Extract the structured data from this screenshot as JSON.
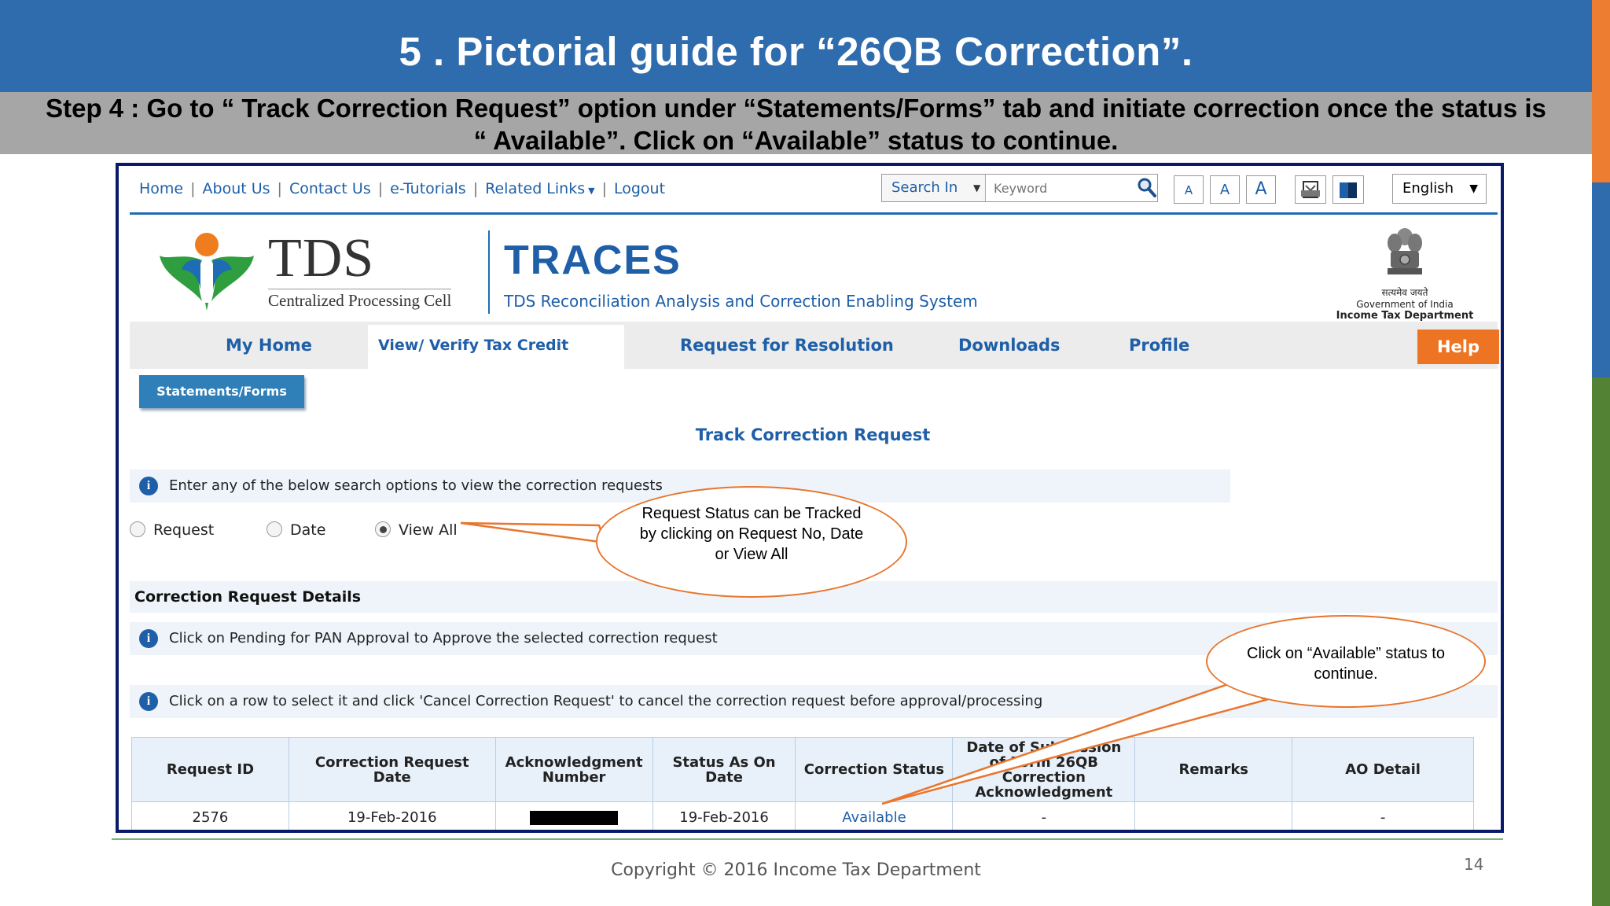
{
  "slide": {
    "title": "5 . Pictorial guide for “26QB Correction”.",
    "step_line1": "Step 4 : Go to “ Track Correction Request” option under “Statements/Forms” tab and initiate correction once the status is",
    "step_line2": "“ Available”. Click on “Available” status to continue.",
    "copyright": "Copyright © 2016 Income Tax Department",
    "page_number": "14"
  },
  "topnav": {
    "links": [
      "Home",
      "About Us",
      "Contact Us",
      "e-Tutorials",
      "Related Links",
      "Logout"
    ],
    "search_label": "Search In",
    "search_placeholder": "Keyword",
    "font_sizes": [
      "A",
      "A",
      "A"
    ],
    "language": "English"
  },
  "header": {
    "tds": "TDS",
    "cpc": "Centralized Processing Cell",
    "traces": "TRACES",
    "traces_sub": "TDS Reconciliation Analysis and Correction Enabling System",
    "emblem_hindi": "सत्यमेव जयते",
    "emblem_goi": "Government of India",
    "emblem_itd": "Income Tax Department"
  },
  "menu": {
    "items": [
      "My Home",
      "View/ Verify Tax Credit",
      "Request for Resolution",
      "Downloads",
      "Profile"
    ],
    "help": "Help",
    "sub_tab": "Statements/Forms"
  },
  "page": {
    "heading": "Track Correction Request",
    "search_info": "Enter any of the below search options to view the correction requests",
    "radios": [
      "Request",
      "Date",
      "View All"
    ],
    "section": "Correction Request Details",
    "info_pending": "Click on Pending for PAN Approval to Approve the selected correction request",
    "info_cancel": "Click on a row to select it and click 'Cancel Correction Request' to cancel the correction request before approval/processing"
  },
  "table": {
    "headers": [
      "Request ID",
      "Correction Request Date",
      "Acknowledgment Number",
      "Status As On Date",
      "Correction Status",
      "Date of Submission of Form 26QB Correction Acknowledgment",
      "Remarks",
      "AO Detail"
    ],
    "row": {
      "request_id": "2576",
      "request_date": "19-Feb-2016",
      "status_date": "19-Feb-2016",
      "status": "Available",
      "submission_date": "-",
      "remarks": "",
      "ao_detail": "-"
    }
  },
  "callouts": {
    "radio_note": "Request Status can be Tracked by clicking on Request No, Date or View All",
    "available_note": "Click on “Available” status to continue."
  },
  "colors": {
    "title_bar": "#2f6cae",
    "step_bar": "#a6a6a6",
    "link_blue": "#1e5fa8",
    "callout_orange": "#e8762d",
    "help_orange": "#ed7422"
  }
}
